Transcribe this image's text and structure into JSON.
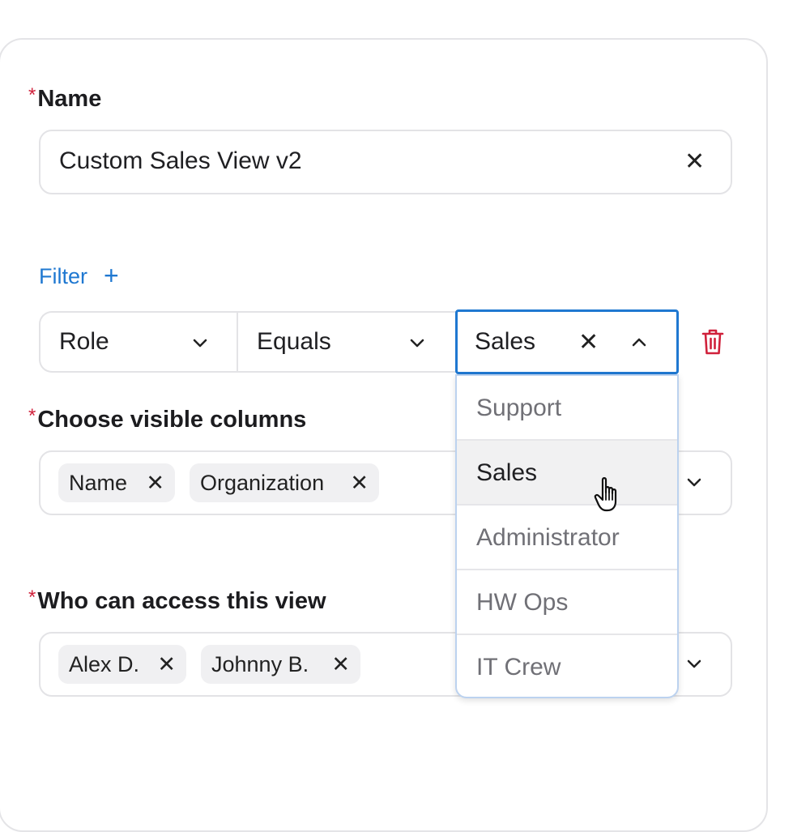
{
  "colors": {
    "accent": "#1f78d1",
    "required": "#d0213b",
    "danger": "#d0213b",
    "border": "#e3e3e6"
  },
  "name_field": {
    "required_mark": "*",
    "label": "Name",
    "value": "Custom Sales View v2",
    "clear_icon": "close-icon"
  },
  "filter": {
    "link_label": "Filter",
    "add_label": "+",
    "field": "Role",
    "operator": "Equals",
    "value": "Sales",
    "delete_icon": "trash-icon",
    "options": [
      "Support",
      "Sales",
      "Administrator",
      "HW Ops",
      "IT Crew"
    ],
    "hovered_option": "Sales"
  },
  "columns_field": {
    "required_mark": "*",
    "label": "Choose visible columns",
    "chips": [
      "Name",
      "Organization"
    ]
  },
  "access_field": {
    "required_mark": "*",
    "label": "Who can access this view",
    "chips": [
      "Alex D.",
      "Johnny B."
    ]
  },
  "chip_remove_glyph": "✕",
  "clear_glyph": "✕"
}
